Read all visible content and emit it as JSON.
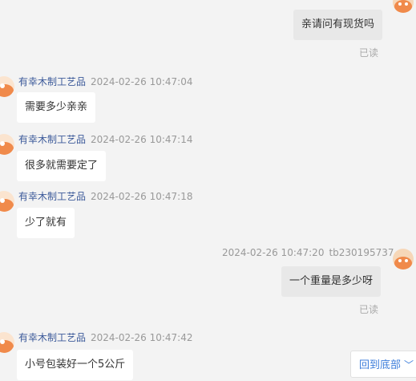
{
  "messages": [
    {
      "side": "right",
      "text": "亲请问有现货吗",
      "read": "已读"
    },
    {
      "side": "left",
      "sender": "有幸木制工艺品",
      "time": "2024-02-26 10:47:04",
      "text": "需要多少亲亲"
    },
    {
      "side": "left",
      "sender": "有幸木制工艺品",
      "time": "2024-02-26 10:47:14",
      "text": "很多就需要定了"
    },
    {
      "side": "left",
      "sender": "有幸木制工艺品",
      "time": "2024-02-26 10:47:18",
      "text": "少了就有"
    },
    {
      "side": "right",
      "time": "2024-02-26 10:47:20",
      "sender": "tb230195737",
      "text": "一个重量是多少呀",
      "read": "已读"
    },
    {
      "side": "left",
      "sender": "有幸木制工艺品",
      "time": "2024-02-26 10:47:42",
      "text": "小号包装好一个5公斤"
    }
  ],
  "back_to_bottom": {
    "label": "回到底部",
    "icon": "chevron-down-icon"
  },
  "colors": {
    "background": "#f3f3f3",
    "sender": "#3c5a9a",
    "link": "#3d7edb",
    "avatar": "#f08a4b"
  }
}
